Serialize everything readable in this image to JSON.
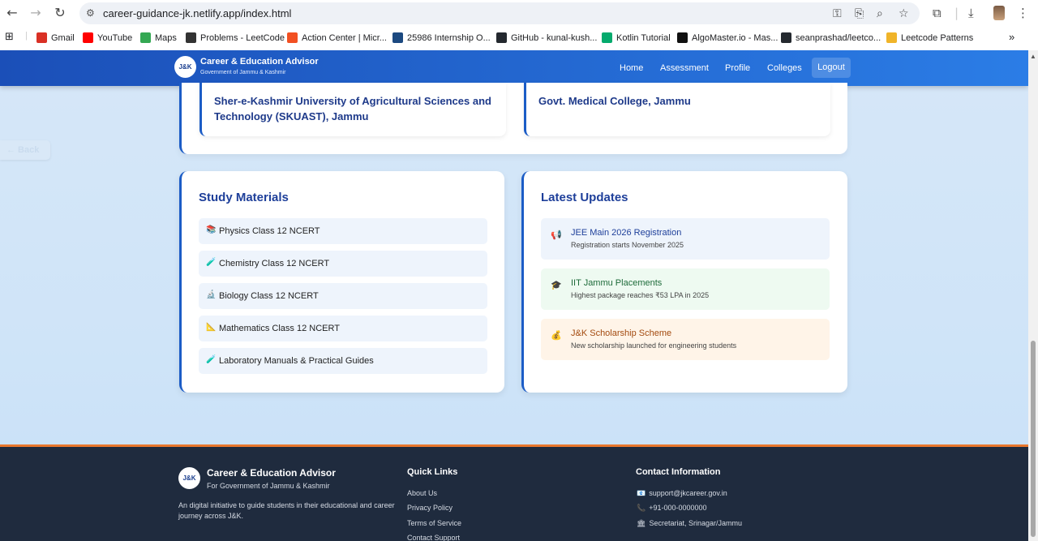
{
  "browser": {
    "url": "career-guidance-jk.netlify.app/index.html",
    "bookmarks": [
      {
        "label": "Gmail",
        "icon": "gmail-icon",
        "color": "#d93025"
      },
      {
        "label": "YouTube",
        "icon": "youtube-icon",
        "color": "#ff0000"
      },
      {
        "label": "Maps",
        "icon": "maps-icon",
        "color": "#34a853"
      },
      {
        "label": "Problems - LeetCode",
        "icon": "leetcode-icon",
        "color": "#333333"
      },
      {
        "label": "Action Center | Micr...",
        "icon": "microsoft-icon",
        "color": "#f25022"
      },
      {
        "label": "25986 Internship O...",
        "icon": "unstop-icon",
        "color": "#1c4980"
      },
      {
        "label": "GitHub - kunal-kush...",
        "icon": "github-icon",
        "color": "#24292f"
      },
      {
        "label": "Kotlin Tutorial",
        "icon": "w3schools-icon",
        "color": "#04aa6d"
      },
      {
        "label": "AlgoMaster.io - Mas...",
        "icon": "algomaster-icon",
        "color": "#111111"
      },
      {
        "label": "seanprashad/leetco...",
        "icon": "github-icon",
        "color": "#24292f"
      },
      {
        "label": "Leetcode Patterns",
        "icon": "leetcode-patterns-icon",
        "color": "#f0b429"
      }
    ]
  },
  "header": {
    "logo": "J&K",
    "title": "Career & Education Advisor",
    "subtitle": "Government of Jammu & Kashmir",
    "nav": [
      "Home",
      "Assessment",
      "Profile",
      "Colleges"
    ],
    "logout": "Logout"
  },
  "back_button": "← Back",
  "colleges": [
    "Sher-e-Kashmir University of Agricultural Sciences and Technology (SKUAST), Jammu",
    "Govt. Medical College, Jammu"
  ],
  "study_materials": {
    "title": "Study Materials",
    "items": [
      {
        "icon": "📚",
        "label": "Physics Class 12 NCERT"
      },
      {
        "icon": "🧪",
        "label": "Chemistry Class 12 NCERT"
      },
      {
        "icon": "🔬",
        "label": "Biology Class 12 NCERT"
      },
      {
        "icon": "📐",
        "label": "Mathematics Class 12 NCERT"
      },
      {
        "icon": "🧪",
        "label": "Laboratory Manuals & Practical Guides"
      }
    ]
  },
  "latest_updates": {
    "title": "Latest Updates",
    "items": [
      {
        "icon": "📢",
        "title": "JEE Main 2026 Registration",
        "desc": "Registration starts November 2025",
        "bg": "#eef4fc",
        "color": "#1e3f9a"
      },
      {
        "icon": "🎓",
        "title": "IIT Jammu Placements",
        "desc": "Highest package reaches ₹53 LPA in 2025",
        "bg": "#eefaf1",
        "color": "#1e6b3a"
      },
      {
        "icon": "💰",
        "title": "J&K Scholarship Scheme",
        "desc": "New scholarship launched for engineering students",
        "bg": "#fff4e8",
        "color": "#a34a0f"
      }
    ]
  },
  "footer": {
    "logo": "J&K",
    "title": "Career & Education Advisor",
    "subtitle": "For Government of Jammu & Kashmir",
    "description": "An digital initiative to guide students in their educational and career journey across J&K.",
    "quick_links_title": "Quick Links",
    "quick_links": [
      "About Us",
      "Privacy Policy",
      "Terms of Service",
      "Contact Support"
    ],
    "contact_title": "Contact Information",
    "contacts": [
      {
        "icon": "📧",
        "text": "support@jkcareer.gov.in"
      },
      {
        "icon": "📞",
        "text": "+91-000-0000000"
      },
      {
        "icon": "🏛",
        "text": "Secretariat, Srinagar/Jammu"
      }
    ]
  }
}
